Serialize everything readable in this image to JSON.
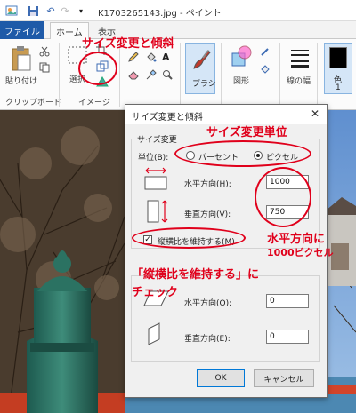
{
  "titlebar": {
    "title": "K1703265143.jpg - ペイント"
  },
  "tabs": {
    "file": "ファイル",
    "home": "ホーム",
    "view": "表示"
  },
  "ribbon": {
    "paste": "貼り付け",
    "clipboard_group": "クリップボード",
    "select": "選択",
    "image_group": "イメージ",
    "brush": "ブラシ",
    "shapes": "図形",
    "line_width": "線の幅",
    "color1": "色",
    "color1_num": "1"
  },
  "annotations": {
    "resize_skew": "サイズ変更と傾斜",
    "resize_unit": "サイズ変更単位",
    "horizontal_1000_line1": "水平方向に",
    "horizontal_1000_line2": "1000ピクセル",
    "keep_ratio_line1": "「縦横比を維持する」に",
    "keep_ratio_line2": "チェック"
  },
  "dialog": {
    "title": "サイズ変更と傾斜",
    "close_glyph": "✕",
    "resize_group": "サイズ変更",
    "unit_label": "単位(B):",
    "percent": "パーセント",
    "pixel": "ピクセル",
    "unit_selected": "pixel",
    "horizontal_label": "水平方向(H):",
    "horizontal_value": "1000",
    "vertical_label": "垂直方向(V):",
    "vertical_value": "750",
    "keep_ratio": "縦横比を維持する(M)",
    "keep_ratio_checked": true,
    "skew_group": "傾斜 (度)",
    "skew_h_label": "水平方向(O):",
    "skew_h_value": "0",
    "skew_v_label": "垂直方向(E):",
    "skew_v_value": "0",
    "ok": "OK",
    "cancel": "キャンセル"
  },
  "colors": {
    "accent": "#1e5aa8",
    "annotation": "#e0001b"
  }
}
